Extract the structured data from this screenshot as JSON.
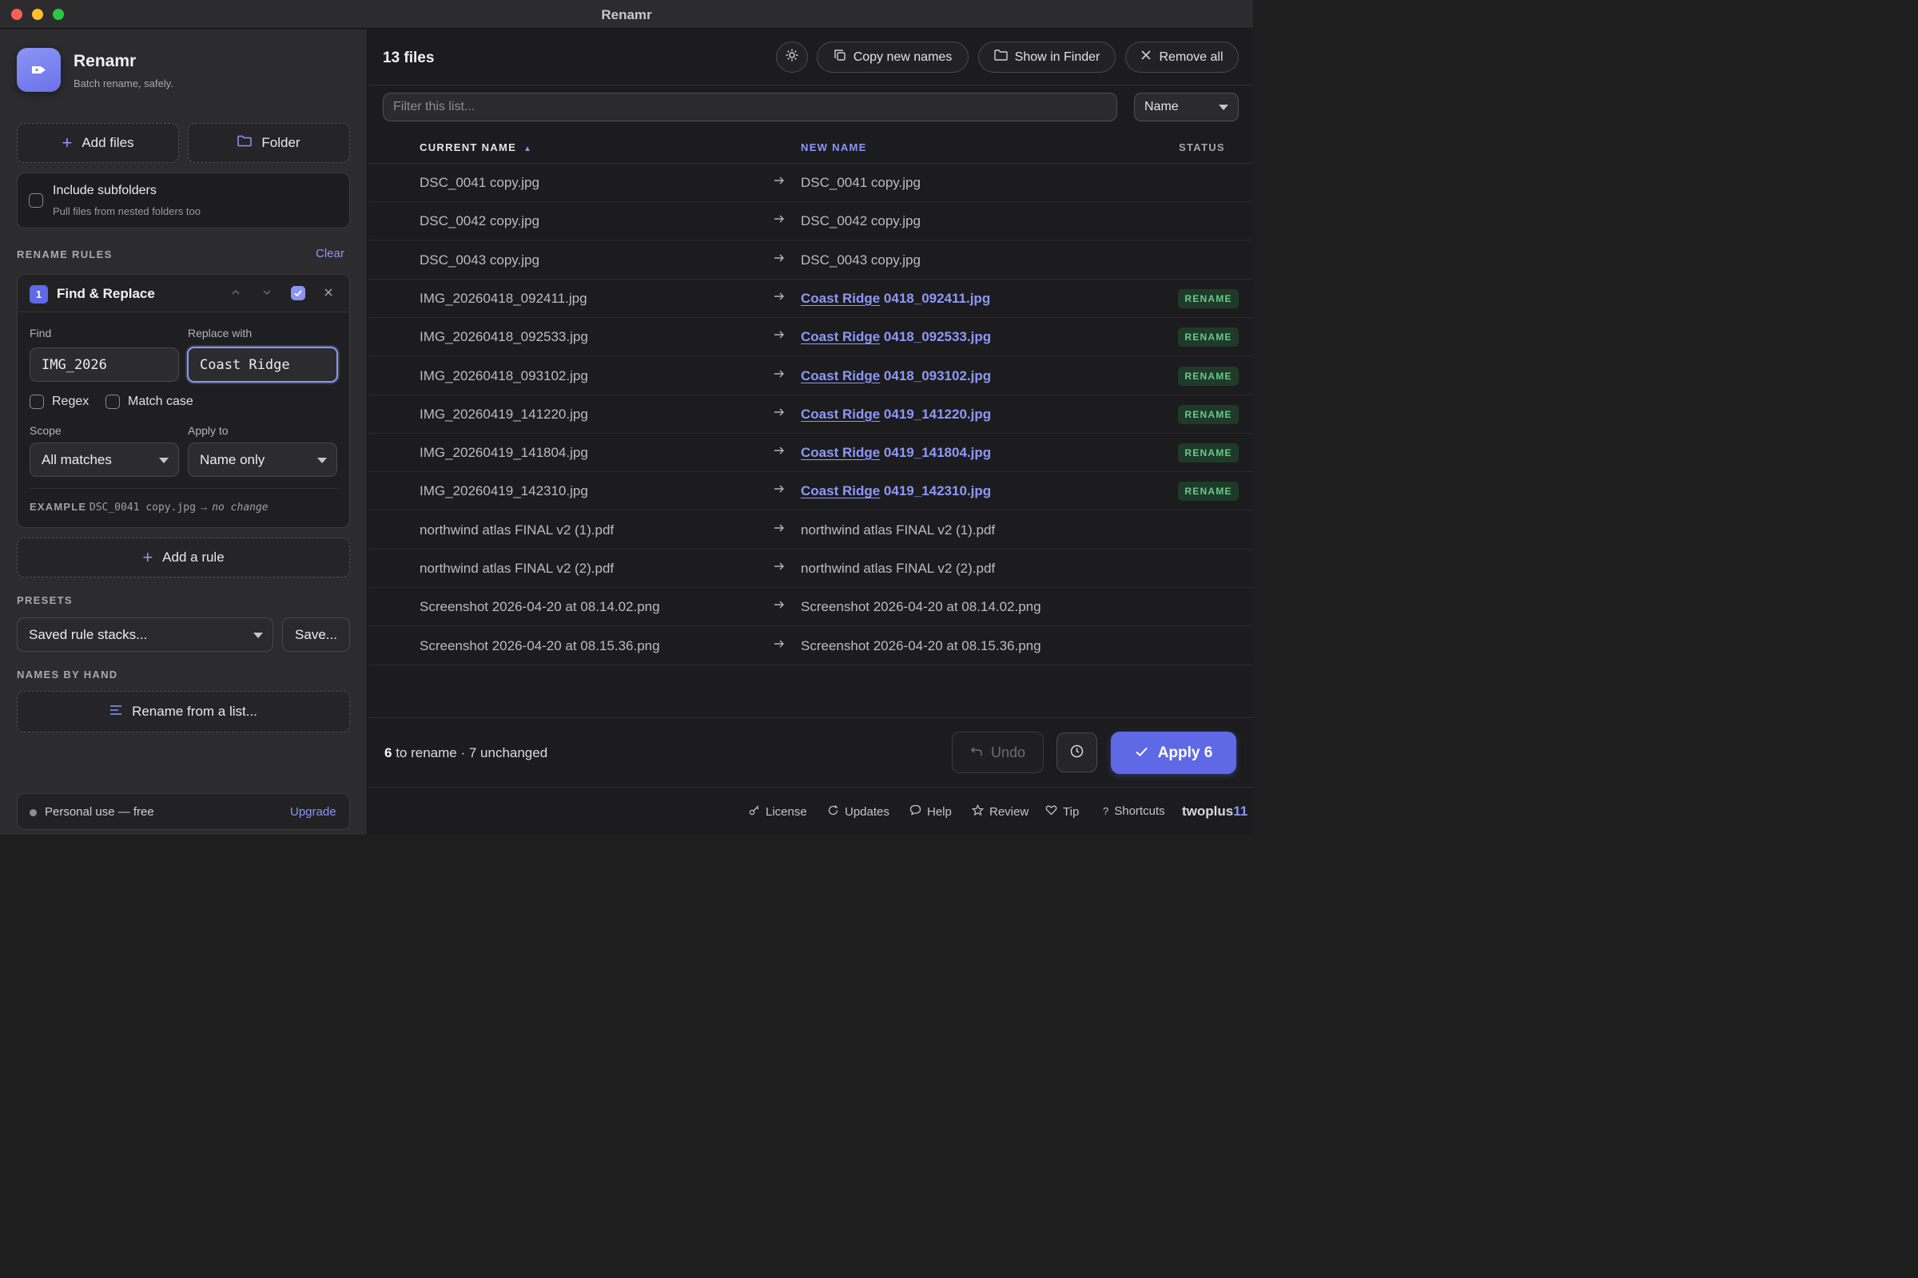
{
  "window": {
    "title": "Renamr"
  },
  "app": {
    "name": "Renamr",
    "tagline": "Batch rename, safely."
  },
  "sources": {
    "add_files_label": "Add files",
    "folder_label": "Folder",
    "subfolders": {
      "label": "Include subfolders",
      "hint": "Pull files from nested folders too",
      "checked": false
    }
  },
  "rules": {
    "section_label": "RENAME RULES",
    "clear_label": "Clear",
    "rule": {
      "number": "1",
      "title": "Find & Replace",
      "find_label": "Find",
      "find_value": "IMG_2026",
      "replace_label": "Replace with",
      "replace_value": "Coast Ridge",
      "regex_label": "Regex",
      "match_case_label": "Match case",
      "scope_label": "Scope",
      "scope_value": "All matches",
      "apply_to_label": "Apply to",
      "apply_to_value": "Name only",
      "example_label": "EXAMPLE",
      "example_input": "DSC_0041 copy.jpg",
      "example_arrow": "→",
      "example_result": "no change"
    },
    "add_rule_label": "Add a rule"
  },
  "presets": {
    "section_label": "PRESETS",
    "select_value": "Saved rule stacks...",
    "save_label": "Save..."
  },
  "by_hand": {
    "section_label": "NAMES BY HAND",
    "button_label": "Rename from a list..."
  },
  "license_bar": {
    "text": "Personal use — free",
    "upgrade_label": "Upgrade"
  },
  "header": {
    "files_count": "13 files",
    "copy_names_label": "Copy new names",
    "show_finder_label": "Show in Finder",
    "remove_all_label": "Remove all"
  },
  "filter": {
    "placeholder": "Filter this list...",
    "sort_value": "Name"
  },
  "table": {
    "col_current": "CURRENT NAME",
    "sort_indicator": "▲",
    "col_new": "NEW NAME",
    "col_status": "STATUS",
    "rows": [
      {
        "current": "DSC_0041 copy.jpg",
        "new_prefix": "",
        "new_rest": "DSC_0041 copy.jpg",
        "status": ""
      },
      {
        "current": "DSC_0042 copy.jpg",
        "new_prefix": "",
        "new_rest": "DSC_0042 copy.jpg",
        "status": ""
      },
      {
        "current": "DSC_0043 copy.jpg",
        "new_prefix": "",
        "new_rest": "DSC_0043 copy.jpg",
        "status": ""
      },
      {
        "current": "IMG_20260418_092411.jpg",
        "new_prefix": "Coast Ridge",
        "new_rest": "0418_092411.jpg",
        "status": "RENAME"
      },
      {
        "current": "IMG_20260418_092533.jpg",
        "new_prefix": "Coast Ridge",
        "new_rest": "0418_092533.jpg",
        "status": "RENAME"
      },
      {
        "current": "IMG_20260418_093102.jpg",
        "new_prefix": "Coast Ridge",
        "new_rest": "0418_093102.jpg",
        "status": "RENAME"
      },
      {
        "current": "IMG_20260419_141220.jpg",
        "new_prefix": "Coast Ridge",
        "new_rest": "0419_141220.jpg",
        "status": "RENAME"
      },
      {
        "current": "IMG_20260419_141804.jpg",
        "new_prefix": "Coast Ridge",
        "new_rest": "0419_141804.jpg",
        "status": "RENAME"
      },
      {
        "current": "IMG_20260419_142310.jpg",
        "new_prefix": "Coast Ridge",
        "new_rest": "0419_142310.jpg",
        "status": "RENAME"
      },
      {
        "current": "northwind atlas FINAL v2 (1).pdf",
        "new_prefix": "",
        "new_rest": "northwind atlas FINAL v2 (1).pdf",
        "status": ""
      },
      {
        "current": "northwind atlas FINAL v2 (2).pdf",
        "new_prefix": "",
        "new_rest": "northwind atlas FINAL v2 (2).pdf",
        "status": ""
      },
      {
        "current": "Screenshot 2026-04-20 at 08.14.02.png",
        "new_prefix": "",
        "new_rest": "Screenshot 2026-04-20 at 08.14.02.png",
        "status": ""
      },
      {
        "current": "Screenshot 2026-04-20 at 08.15.36.png",
        "new_prefix": "",
        "new_rest": "Screenshot 2026-04-20 at 08.15.36.png",
        "status": ""
      }
    ]
  },
  "summary": {
    "rename_count": "6",
    "rename_text": "to rename · 7 unchanged"
  },
  "actions": {
    "undo_label": "Undo",
    "apply_label": "Apply 6"
  },
  "bottom_bar": {
    "license": "License",
    "updates": "Updates",
    "help": "Help",
    "review": "Review",
    "tip": "Tip",
    "shortcuts": "Shortcuts",
    "brand_main": "twoplus",
    "brand_accent": "11"
  },
  "colors": {
    "accent": "#8c95f7",
    "apply_button": "#5f69e6",
    "rename_badge_bg": "#1f3a28",
    "rename_badge_text": "#67c98b"
  }
}
